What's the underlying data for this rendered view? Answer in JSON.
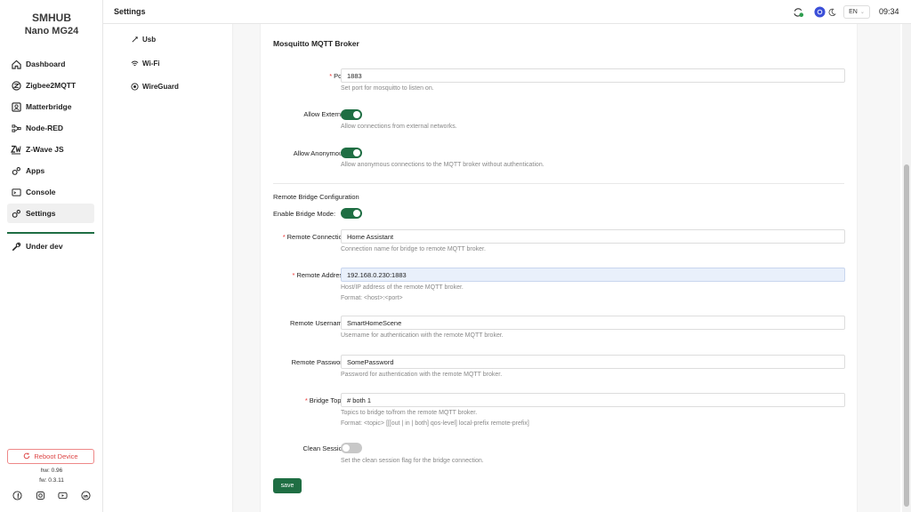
{
  "brand": {
    "line1": "SMHUB",
    "line2": "Nano MG24"
  },
  "sidebar": {
    "items": [
      {
        "label": "Dashboard",
        "icon": "home-icon"
      },
      {
        "label": "Zigbee2MQTT",
        "icon": "zigbee-icon"
      },
      {
        "label": "Matterbridge",
        "icon": "matter-icon"
      },
      {
        "label": "Node-RED",
        "icon": "node-red-icon"
      },
      {
        "label": "Z-Wave JS",
        "icon": "zwave-icon"
      },
      {
        "label": "Apps",
        "icon": "apps-icon"
      },
      {
        "label": "Console",
        "icon": "console-icon"
      },
      {
        "label": "Settings",
        "icon": "settings-icon",
        "active": true
      }
    ],
    "under_dev": "Under dev",
    "reboot_label": "Reboot Device",
    "hw": "hw: 0.96",
    "fw": "fw: 0.3.11"
  },
  "header": {
    "title": "Settings",
    "language": "EN",
    "time": "09:34"
  },
  "subnav": {
    "items": [
      {
        "label": "Usb"
      },
      {
        "label": "Wi-Fi"
      },
      {
        "label": "WireGuard"
      }
    ]
  },
  "form": {
    "section_title": "Mosquitto MQTT Broker",
    "port": {
      "label": "Port:",
      "value": "1883",
      "help": "Set port for mosquitto to listen on."
    },
    "allow_external": {
      "label": "Allow External:",
      "on": true,
      "help": "Allow connections from external networks."
    },
    "allow_anonymous": {
      "label": "Allow Anonymous:",
      "on": true,
      "help": "Allow anonymous connections to the MQTT broker without authentication."
    },
    "bridge_section": "Remote Bridge Configuration",
    "enable_bridge": {
      "label": "Enable Bridge Mode:",
      "on": true
    },
    "remote_connection": {
      "label": "Remote Connection:",
      "value": "Home Assistant",
      "help": "Connection name for bridge to remote MQTT broker."
    },
    "remote_address": {
      "label": "Remote Address:",
      "value": "192.168.0.230:1883",
      "help1": "Host/IP address of the remote MQTT broker.",
      "help2": "Format: <host>:<port>"
    },
    "remote_username": {
      "label": "Remote Username:",
      "value": "SmartHomeScene",
      "help": "Username for authentication with the remote MQTT broker."
    },
    "remote_password": {
      "label": "Remote Password:",
      "value": "SomePassword",
      "help": "Password for authentication with the remote MQTT broker."
    },
    "bridge_topic": {
      "label": "Bridge Topic:",
      "value": "# both 1",
      "help1": "Topics to bridge to/from the remote MQTT broker.",
      "help2": "Format: <topic> [[[out | in | both] qos-level] local-prefix remote-prefix]"
    },
    "clean_session": {
      "label": "Clean Session:",
      "on": false,
      "help": "Set the clean session flag for the bridge connection."
    },
    "save_label": "save"
  },
  "colors": {
    "accent": "#1f6e43",
    "danger": "#dd4444"
  }
}
